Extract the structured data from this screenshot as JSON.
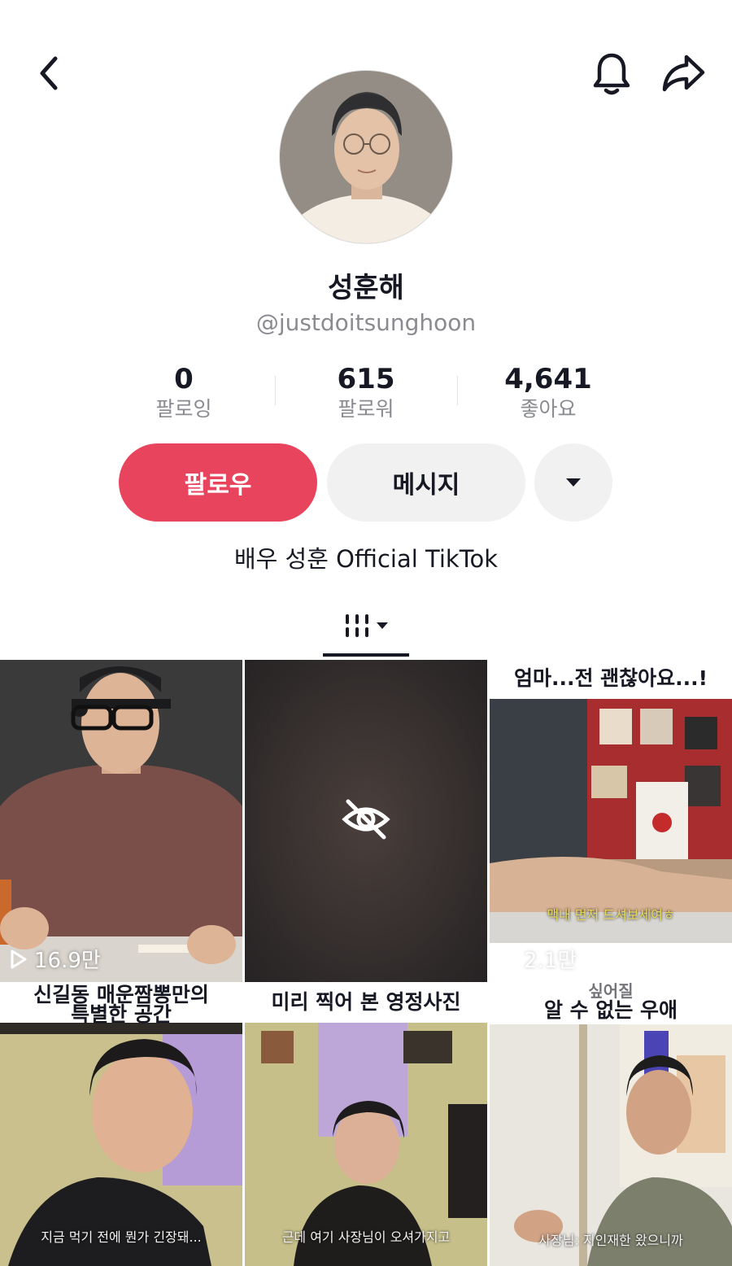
{
  "header": {
    "back_icon": "chevron-left-icon",
    "bell_icon": "bell-icon",
    "share_icon": "share-arrow-icon"
  },
  "profile": {
    "name": "성훈해",
    "handle": "@justdoitsunghoon",
    "bio": "배우 성훈 Official TikTok"
  },
  "stats": [
    {
      "value": "0",
      "label": "팔로잉"
    },
    {
      "value": "615",
      "label": "팔로워"
    },
    {
      "value": "4,641",
      "label": "좋아요"
    }
  ],
  "actions": {
    "follow_label": "팔로우",
    "message_label": "메시지",
    "more_icon": "caret-down-icon"
  },
  "tabs": {
    "grid_icon": "grid-icon"
  },
  "videos": [
    {
      "views": "16.9만",
      "caption": "",
      "subtitle": ""
    },
    {
      "views": "",
      "caption": "",
      "subtitle": "",
      "hidden_icon": "eye-off-icon"
    },
    {
      "views": "2.1만",
      "caption": "엄마...전 괜찮아요...!",
      "subtitle": "맥내 먼저 드셔보세여ㅎ"
    },
    {
      "views": "",
      "caption_line1": "신길동 매운짬뽕만의",
      "caption_line2": "특별한 공간",
      "subtitle": "지금 먹기 전에 뭔가 긴장돼..."
    },
    {
      "views": "",
      "caption": "미리 찍어 본 영정사진",
      "subtitle": "근데 여기 사장님이 오셔가지고"
    },
    {
      "views": "",
      "caption_line1": "싶어질",
      "caption_line2": "알 수 없는 우애",
      "subtitle": "사장님: 지인재한 왔으니까"
    }
  ],
  "colors": {
    "accent": "#e8445d",
    "secondary_button": "#f1f1f2",
    "muted_text": "#8a8b91"
  }
}
